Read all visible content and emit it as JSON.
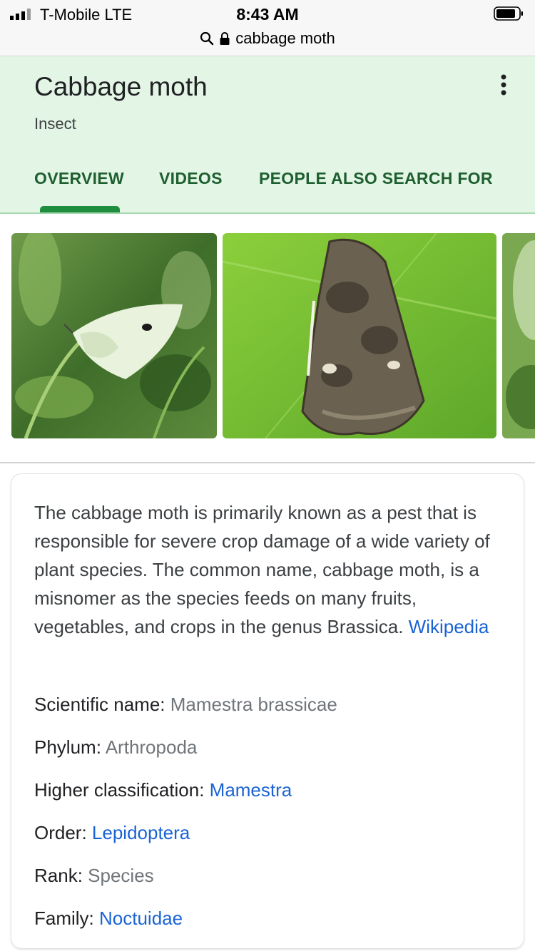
{
  "status": {
    "carrier": "T-Mobile  LTE",
    "time": "8:43 AM",
    "url": "cabbage moth"
  },
  "entity": {
    "title": "Cabbage moth",
    "subtitle": "Insect"
  },
  "tabs": [
    {
      "label": "OVERVIEW",
      "active": true
    },
    {
      "label": "VIDEOS",
      "active": false
    },
    {
      "label": "PEOPLE ALSO SEARCH FOR",
      "active": false
    }
  ],
  "images": [
    {
      "name": "white butterfly on leaves"
    },
    {
      "name": "mottled brown moth on leaf"
    },
    {
      "name": "partial green image"
    }
  ],
  "description": {
    "text": "The cabbage moth is primarily known as a pest that is responsible for severe crop damage of a wide variety of plant species. The common name, cabbage moth, is a misnomer as the species feeds on many fruits, vegetables, and crops in the genus Brassica. ",
    "source": "Wikipedia"
  },
  "facts": [
    {
      "label": "Scientific name: ",
      "value": "Mamestra brassicae",
      "is_link": false
    },
    {
      "label": "Phylum: ",
      "value": "Arthropoda",
      "is_link": false
    },
    {
      "label": "Higher classification: ",
      "value": "Mamestra",
      "is_link": true
    },
    {
      "label": "Order: ",
      "value": "Lepidoptera",
      "is_link": true
    },
    {
      "label": "Rank: ",
      "value": "Species",
      "is_link": false
    },
    {
      "label": "Family: ",
      "value": "Noctuidae",
      "is_link": true
    }
  ],
  "colors": {
    "header_bg": "#e3f5e5",
    "tab_text": "#1e5f30",
    "tab_indicator": "#1e8e3e",
    "link": "#1a63d4"
  }
}
